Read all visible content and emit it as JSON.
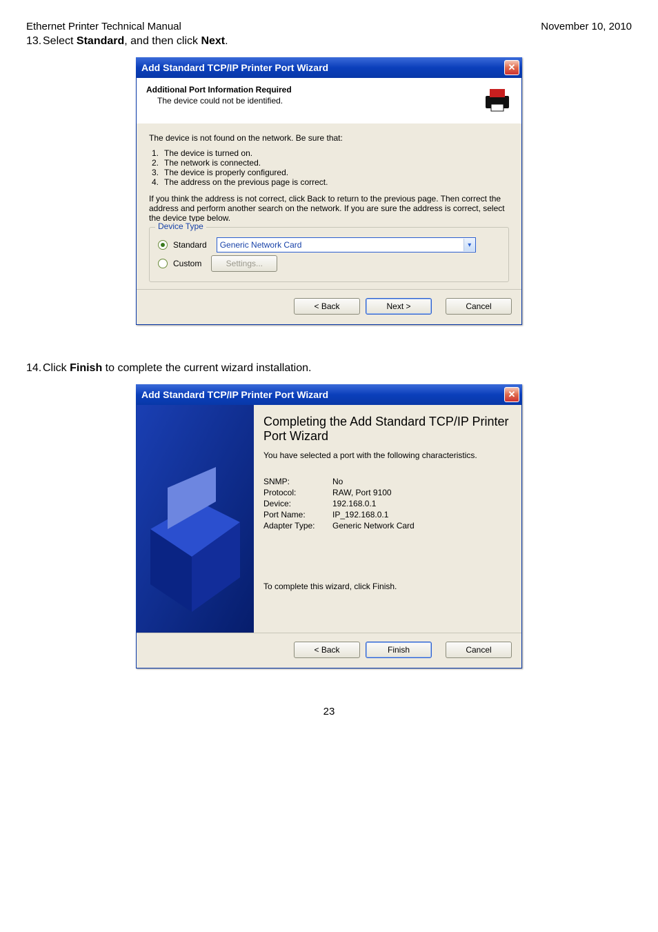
{
  "doc": {
    "header_left": "Ethernet Printer Technical Manual",
    "header_right": "November 10, 2010",
    "page_number": "23"
  },
  "step13": {
    "num": "13.",
    "pre": "Select ",
    "bold1": "Standard",
    "mid": ", and then click ",
    "bold2": "Next",
    "post": "."
  },
  "step14": {
    "num": "14.",
    "pre": "Click ",
    "bold1": "Finish",
    "post": " to complete the current wizard installation."
  },
  "dialog1": {
    "title": "Add Standard TCP/IP Printer Port Wizard",
    "header_title": "Additional Port Information Required",
    "header_sub": "The device could not be identified.",
    "intro": "The device is not found on the network.  Be sure that:",
    "items": [
      "The device is turned on.",
      "The network is connected.",
      "The device is properly configured.",
      "The address on the previous page is correct."
    ],
    "para": "If you think the address is not correct, click Back to return to the previous page.  Then correct the address and perform another search on the network.  If you are sure the address is correct, select the device type below.",
    "legend": "Device Type",
    "radio_standard": "Standard",
    "radio_custom": "Custom",
    "combo_value": "Generic Network Card",
    "settings_btn": "Settings...",
    "back_btn": "< Back",
    "next_btn": "Next >",
    "cancel_btn": "Cancel"
  },
  "dialog2": {
    "title": "Add Standard TCP/IP Printer Port Wizard",
    "heading": "Completing the Add Standard TCP/IP Printer Port Wizard",
    "sub": "You have selected a port with the following characteristics.",
    "rows": [
      {
        "k": "SNMP:",
        "v": "No"
      },
      {
        "k": "Protocol:",
        "v": "RAW, Port 9100"
      },
      {
        "k": "Device:",
        "v": "192.168.0.1"
      },
      {
        "k": "Port Name:",
        "v": "IP_192.168.0.1"
      },
      {
        "k": "Adapter Type:",
        "v": "Generic Network Card"
      }
    ],
    "finish_line": "To complete this wizard, click Finish.",
    "back_btn": "< Back",
    "finish_btn": "Finish",
    "cancel_btn": "Cancel"
  }
}
